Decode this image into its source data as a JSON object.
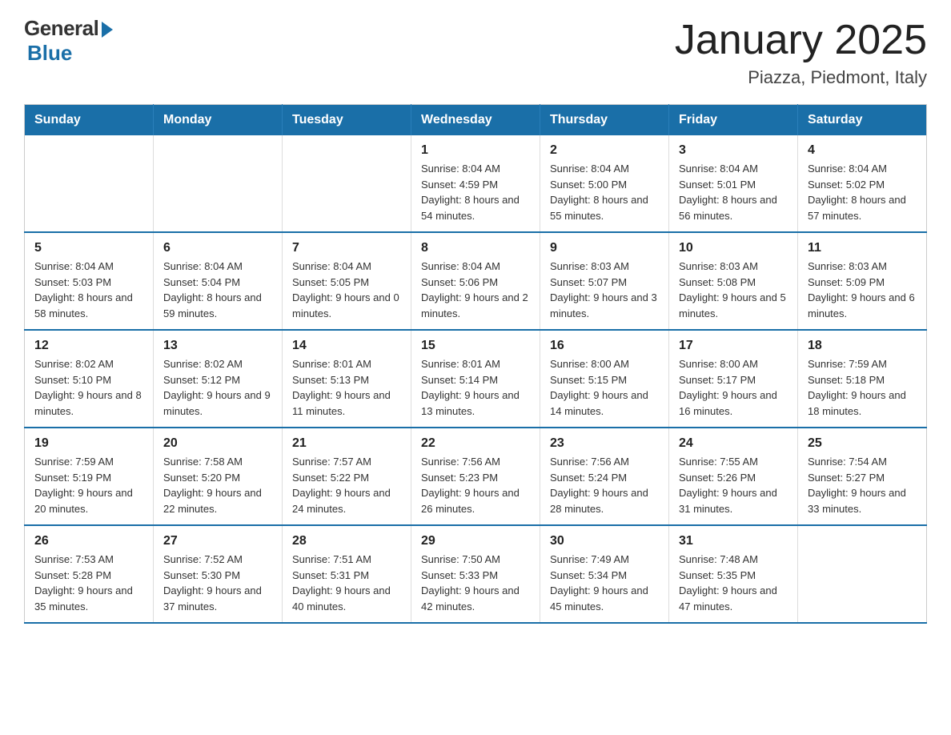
{
  "header": {
    "logo": {
      "general": "General",
      "blue": "Blue"
    },
    "title": "January 2025",
    "location": "Piazza, Piedmont, Italy"
  },
  "days_of_week": [
    "Sunday",
    "Monday",
    "Tuesday",
    "Wednesday",
    "Thursday",
    "Friday",
    "Saturday"
  ],
  "weeks": [
    [
      {
        "day": "",
        "info": ""
      },
      {
        "day": "",
        "info": ""
      },
      {
        "day": "",
        "info": ""
      },
      {
        "day": "1",
        "info": "Sunrise: 8:04 AM\nSunset: 4:59 PM\nDaylight: 8 hours\nand 54 minutes."
      },
      {
        "day": "2",
        "info": "Sunrise: 8:04 AM\nSunset: 5:00 PM\nDaylight: 8 hours\nand 55 minutes."
      },
      {
        "day": "3",
        "info": "Sunrise: 8:04 AM\nSunset: 5:01 PM\nDaylight: 8 hours\nand 56 minutes."
      },
      {
        "day": "4",
        "info": "Sunrise: 8:04 AM\nSunset: 5:02 PM\nDaylight: 8 hours\nand 57 minutes."
      }
    ],
    [
      {
        "day": "5",
        "info": "Sunrise: 8:04 AM\nSunset: 5:03 PM\nDaylight: 8 hours\nand 58 minutes."
      },
      {
        "day": "6",
        "info": "Sunrise: 8:04 AM\nSunset: 5:04 PM\nDaylight: 8 hours\nand 59 minutes."
      },
      {
        "day": "7",
        "info": "Sunrise: 8:04 AM\nSunset: 5:05 PM\nDaylight: 9 hours\nand 0 minutes."
      },
      {
        "day": "8",
        "info": "Sunrise: 8:04 AM\nSunset: 5:06 PM\nDaylight: 9 hours\nand 2 minutes."
      },
      {
        "day": "9",
        "info": "Sunrise: 8:03 AM\nSunset: 5:07 PM\nDaylight: 9 hours\nand 3 minutes."
      },
      {
        "day": "10",
        "info": "Sunrise: 8:03 AM\nSunset: 5:08 PM\nDaylight: 9 hours\nand 5 minutes."
      },
      {
        "day": "11",
        "info": "Sunrise: 8:03 AM\nSunset: 5:09 PM\nDaylight: 9 hours\nand 6 minutes."
      }
    ],
    [
      {
        "day": "12",
        "info": "Sunrise: 8:02 AM\nSunset: 5:10 PM\nDaylight: 9 hours\nand 8 minutes."
      },
      {
        "day": "13",
        "info": "Sunrise: 8:02 AM\nSunset: 5:12 PM\nDaylight: 9 hours\nand 9 minutes."
      },
      {
        "day": "14",
        "info": "Sunrise: 8:01 AM\nSunset: 5:13 PM\nDaylight: 9 hours\nand 11 minutes."
      },
      {
        "day": "15",
        "info": "Sunrise: 8:01 AM\nSunset: 5:14 PM\nDaylight: 9 hours\nand 13 minutes."
      },
      {
        "day": "16",
        "info": "Sunrise: 8:00 AM\nSunset: 5:15 PM\nDaylight: 9 hours\nand 14 minutes."
      },
      {
        "day": "17",
        "info": "Sunrise: 8:00 AM\nSunset: 5:17 PM\nDaylight: 9 hours\nand 16 minutes."
      },
      {
        "day": "18",
        "info": "Sunrise: 7:59 AM\nSunset: 5:18 PM\nDaylight: 9 hours\nand 18 minutes."
      }
    ],
    [
      {
        "day": "19",
        "info": "Sunrise: 7:59 AM\nSunset: 5:19 PM\nDaylight: 9 hours\nand 20 minutes."
      },
      {
        "day": "20",
        "info": "Sunrise: 7:58 AM\nSunset: 5:20 PM\nDaylight: 9 hours\nand 22 minutes."
      },
      {
        "day": "21",
        "info": "Sunrise: 7:57 AM\nSunset: 5:22 PM\nDaylight: 9 hours\nand 24 minutes."
      },
      {
        "day": "22",
        "info": "Sunrise: 7:56 AM\nSunset: 5:23 PM\nDaylight: 9 hours\nand 26 minutes."
      },
      {
        "day": "23",
        "info": "Sunrise: 7:56 AM\nSunset: 5:24 PM\nDaylight: 9 hours\nand 28 minutes."
      },
      {
        "day": "24",
        "info": "Sunrise: 7:55 AM\nSunset: 5:26 PM\nDaylight: 9 hours\nand 31 minutes."
      },
      {
        "day": "25",
        "info": "Sunrise: 7:54 AM\nSunset: 5:27 PM\nDaylight: 9 hours\nand 33 minutes."
      }
    ],
    [
      {
        "day": "26",
        "info": "Sunrise: 7:53 AM\nSunset: 5:28 PM\nDaylight: 9 hours\nand 35 minutes."
      },
      {
        "day": "27",
        "info": "Sunrise: 7:52 AM\nSunset: 5:30 PM\nDaylight: 9 hours\nand 37 minutes."
      },
      {
        "day": "28",
        "info": "Sunrise: 7:51 AM\nSunset: 5:31 PM\nDaylight: 9 hours\nand 40 minutes."
      },
      {
        "day": "29",
        "info": "Sunrise: 7:50 AM\nSunset: 5:33 PM\nDaylight: 9 hours\nand 42 minutes."
      },
      {
        "day": "30",
        "info": "Sunrise: 7:49 AM\nSunset: 5:34 PM\nDaylight: 9 hours\nand 45 minutes."
      },
      {
        "day": "31",
        "info": "Sunrise: 7:48 AM\nSunset: 5:35 PM\nDaylight: 9 hours\nand 47 minutes."
      },
      {
        "day": "",
        "info": ""
      }
    ]
  ]
}
